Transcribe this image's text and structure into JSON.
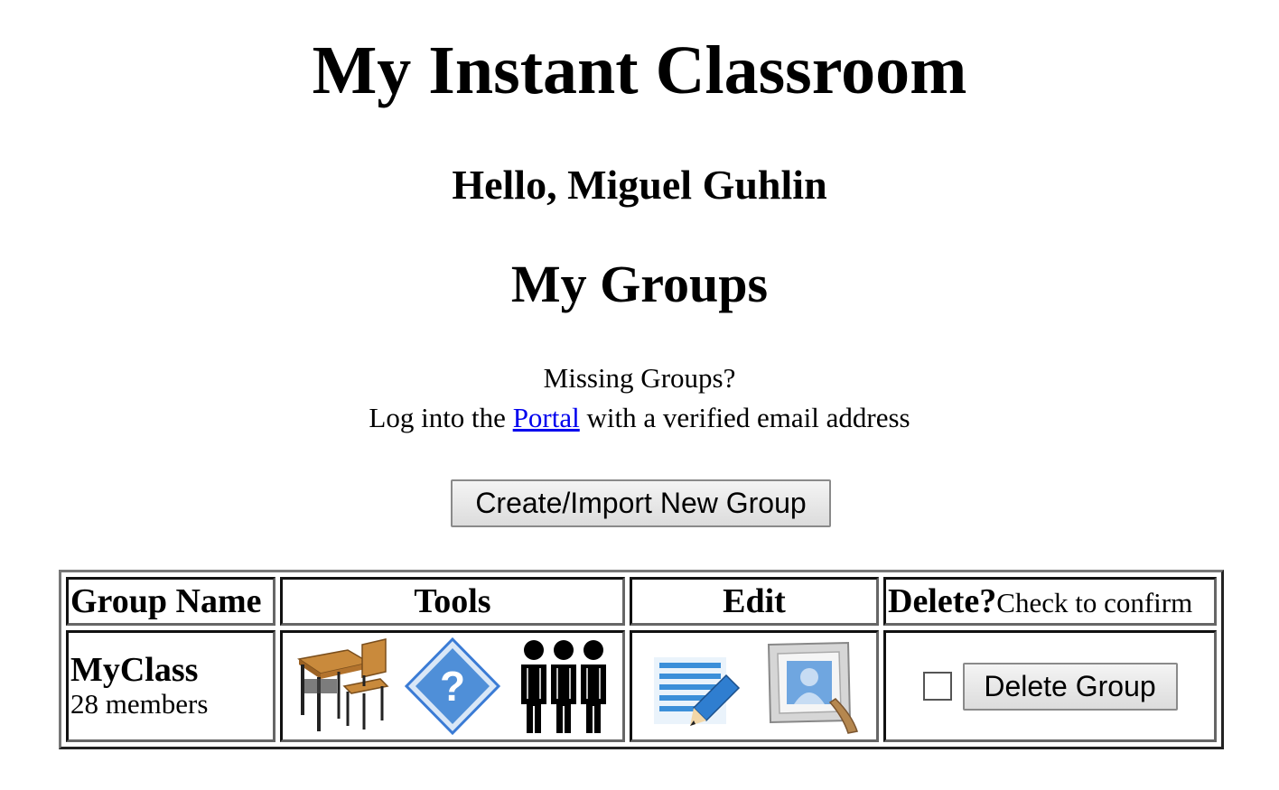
{
  "header": {
    "title": "My Instant Classroom",
    "greeting": "Hello, Miguel Guhlin",
    "section_title": "My Groups"
  },
  "notice": {
    "question": "Missing Groups?",
    "prefix": "Log into the ",
    "link_text": "Portal",
    "suffix": " with a verified email address"
  },
  "actions": {
    "create_label": "Create/Import New Group"
  },
  "table": {
    "headers": {
      "name": "Group Name",
      "tools": "Tools",
      "edit": "Edit",
      "delete": "Delete?",
      "delete_hint": "Check to confirm"
    },
    "rows": [
      {
        "group_name": "MyClass",
        "members": "28 members",
        "tools": [
          "classroom-desk-icon",
          "help-icon",
          "members-icon"
        ],
        "edit": [
          "edit-document-icon",
          "picture-frame-icon"
        ],
        "confirm_checked": false,
        "delete_label": "Delete Group"
      }
    ]
  },
  "colors": {
    "link": "#0000ee",
    "icon_blue": "#3a7bd5"
  }
}
